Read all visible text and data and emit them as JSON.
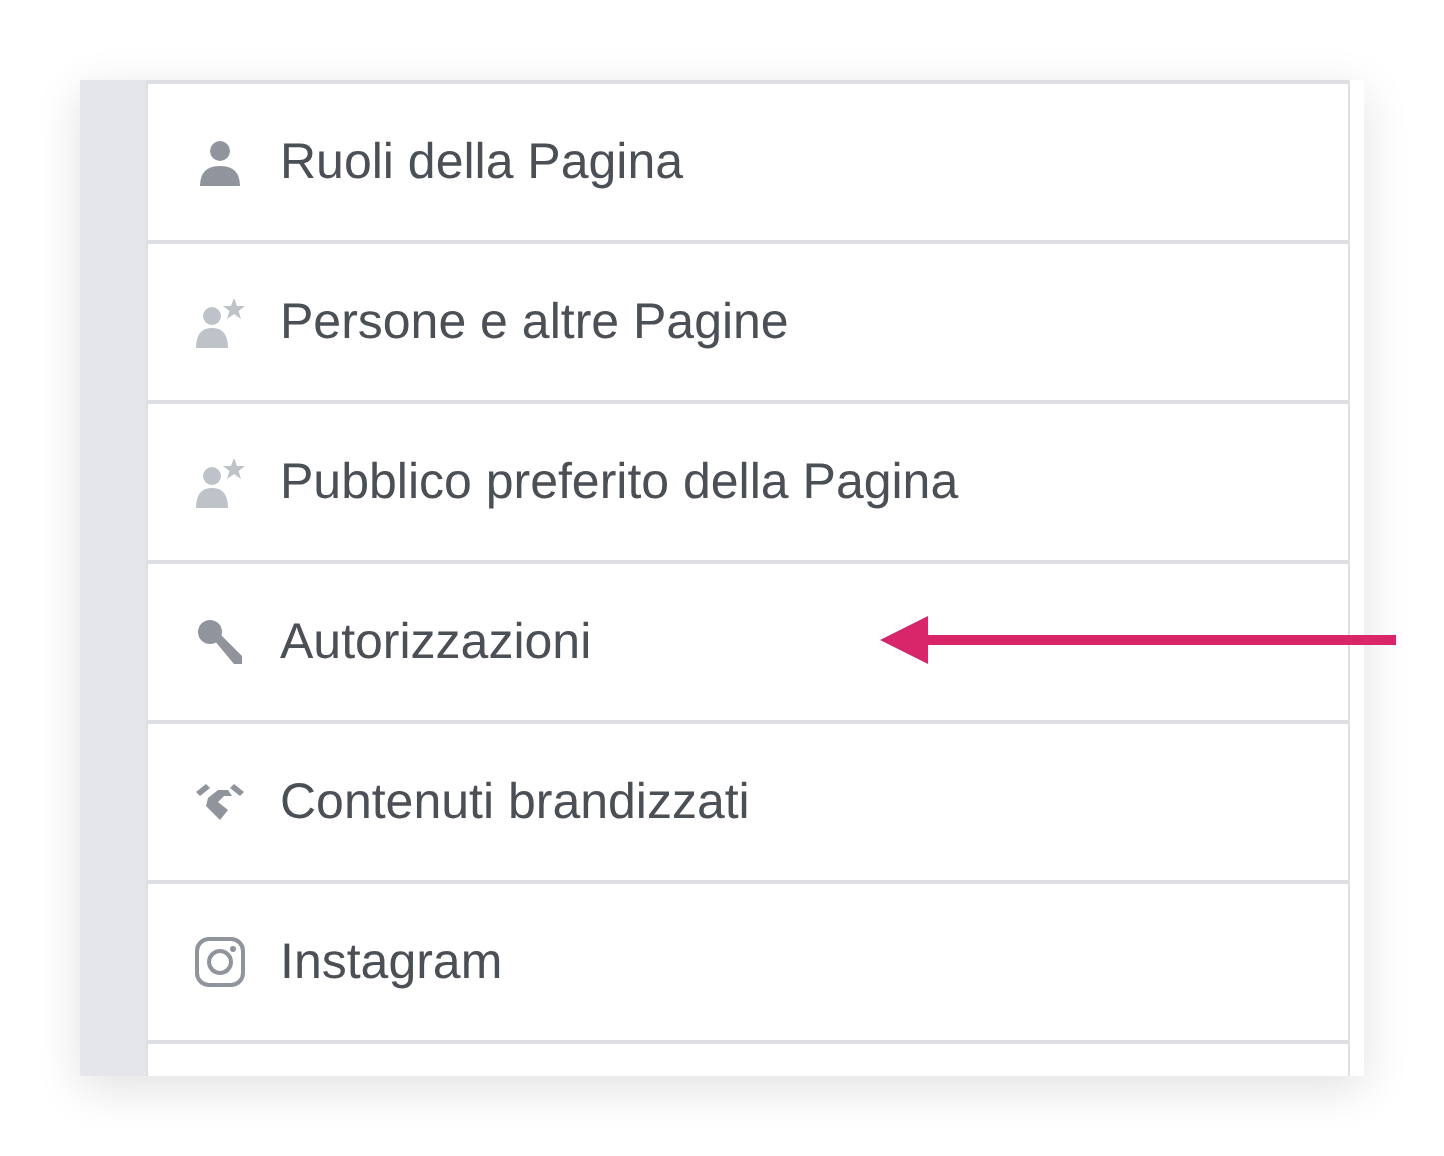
{
  "menu": {
    "items": [
      {
        "label": "Ruoli della Pagina"
      },
      {
        "label": "Persone e altre Pagine"
      },
      {
        "label": "Pubblico preferito della Pagina"
      },
      {
        "label": "Autorizzazioni"
      },
      {
        "label": "Contenuti brandizzati"
      },
      {
        "label": "Instagram"
      }
    ]
  }
}
